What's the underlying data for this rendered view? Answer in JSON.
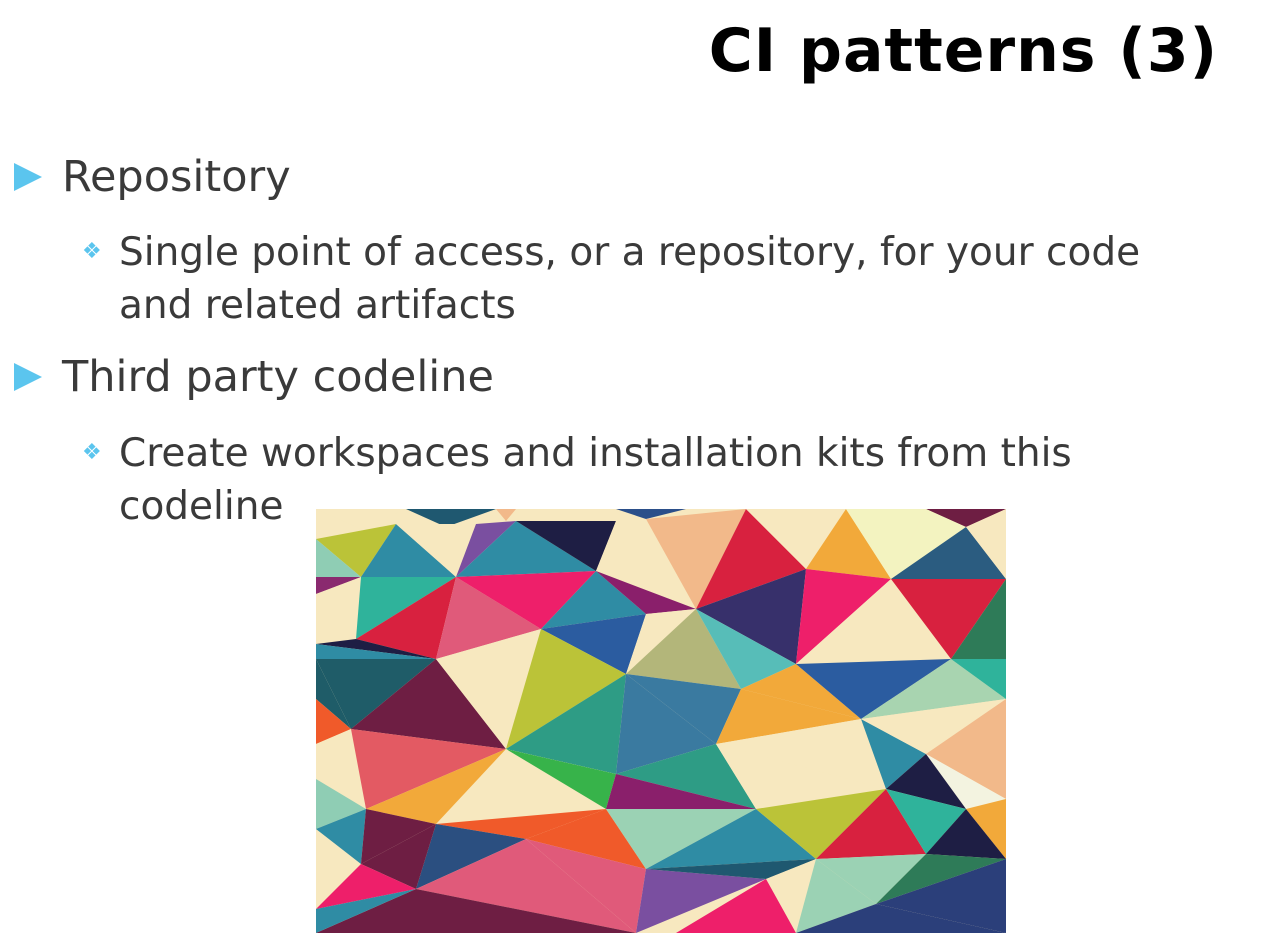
{
  "slide": {
    "title": "CI patterns (3)",
    "bullets": [
      {
        "text": "Repository",
        "sub": [
          "Single point of access, or a repository, for your code and related artifacts"
        ]
      },
      {
        "text": "Third party codeline",
        "sub": [
          "Create workspaces and installation kits from this codeline"
        ]
      }
    ]
  },
  "colors": {
    "bullet_accent": "#5bc5ee",
    "body_text": "#3a3a3a",
    "title_text": "#000000"
  },
  "icons": {
    "level1_bullet": "triangle-right-icon",
    "level2_bullet": "diamond-four-icon"
  }
}
